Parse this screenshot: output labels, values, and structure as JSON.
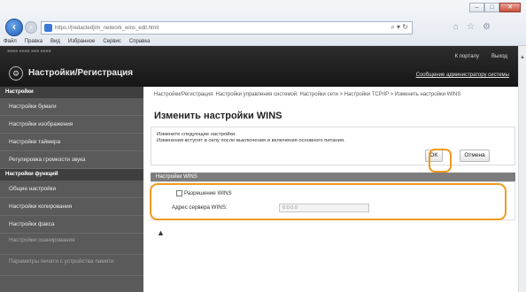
{
  "browser": {
    "url": "https://[redacted]/m_network_wins_edit.html",
    "search_icon": "search-icon",
    "menu": [
      "Файл",
      "Правка",
      "Вид",
      "Избранное",
      "Сервис",
      "Справка"
    ],
    "win_buttons": [
      "–",
      "□",
      "✕"
    ]
  },
  "header": {
    "device_strip": "■■■■ ■■■■  ■■■ ■■■■",
    "title": "Настройки/Регистрация",
    "portal_link": "К порталу",
    "logout_link": "Выход",
    "admin_link": "Сообщение администратору системы"
  },
  "sidebar": {
    "section1": "Настройки",
    "items1": [
      "Настройки бумаги",
      "Настройки изображения",
      "Настройки таймера",
      "Регулировка громкости звука"
    ],
    "section2": "Настройки функций",
    "items2": [
      "Общие настройки",
      "Настройки копирования",
      "Настройки факса",
      "Настройки сканирования",
      "Параметры печати с устройства памяти"
    ]
  },
  "main": {
    "breadcrumb": "Настройки/Регистрация: Настройки управления системой: Настройки сети > Настройки TCP/IP > Изменить настройки WINS",
    "title": "Изменить настройки WINS",
    "info1": "Измените следующие настройки.",
    "info2": "Изменения вступят в силу после выключения и включения основного питания.",
    "ok": "OK",
    "cancel": "Отмена",
    "section": "Настройки WINS",
    "checkbox_label": "Разрешение WINS",
    "server_label": "Адрес сервера WINS:",
    "server_value": "0.0.0.0",
    "top_link": "▲"
  }
}
